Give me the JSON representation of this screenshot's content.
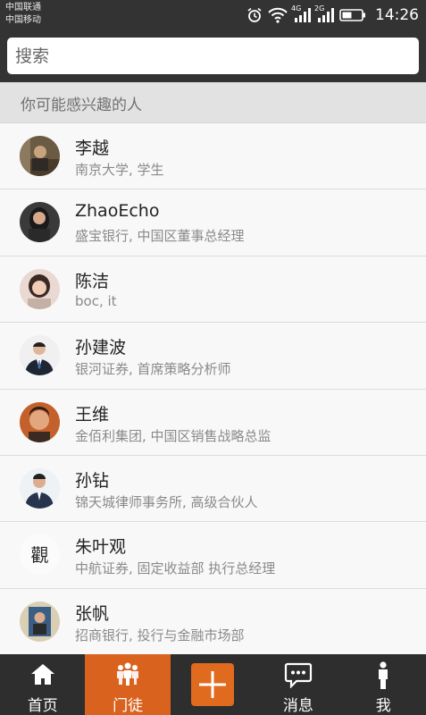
{
  "status_bar": {
    "carrier_1": "中国联通",
    "carrier_2": "中国移动",
    "network_1": "4G",
    "network_2": "2G",
    "time": "14:26",
    "icons": [
      "alarm-icon",
      "wifi-icon",
      "signal-icon",
      "signal-icon",
      "battery-icon"
    ]
  },
  "search": {
    "placeholder": "搜索"
  },
  "section": {
    "title": "你可能感兴趣的人"
  },
  "people": [
    {
      "name": "李越",
      "desc": "南京大学, 学生"
    },
    {
      "name": "ZhaoEcho",
      "desc": "盛宝银行, 中国区董事总经理"
    },
    {
      "name": "陈洁",
      "desc": "boc, it"
    },
    {
      "name": "孙建波",
      "desc": "银河证券, 首席策略分析师"
    },
    {
      "name": "王维",
      "desc": "金佰利集团, 中国区销售战略总监"
    },
    {
      "name": "孙钻",
      "desc": "锦天城律师事务所, 高级合伙人"
    },
    {
      "name": "朱叶观",
      "desc": "中航证券, 固定收益部 执行总经理"
    },
    {
      "name": "张帆",
      "desc": "招商银行, 投行与金融市场部"
    }
  ],
  "avatar_glyph_6": "觀",
  "tabs": [
    {
      "label": "首页",
      "icon": "home-icon"
    },
    {
      "label": "门徒",
      "icon": "people-icon",
      "active": true
    },
    {
      "label": "",
      "icon": "plus-icon"
    },
    {
      "label": "消息",
      "icon": "chat-icon"
    },
    {
      "label": "我",
      "icon": "person-icon"
    }
  ],
  "colors": {
    "accent": "#d9621e",
    "bar": "#333333",
    "tabbar": "#2e2e2e"
  }
}
